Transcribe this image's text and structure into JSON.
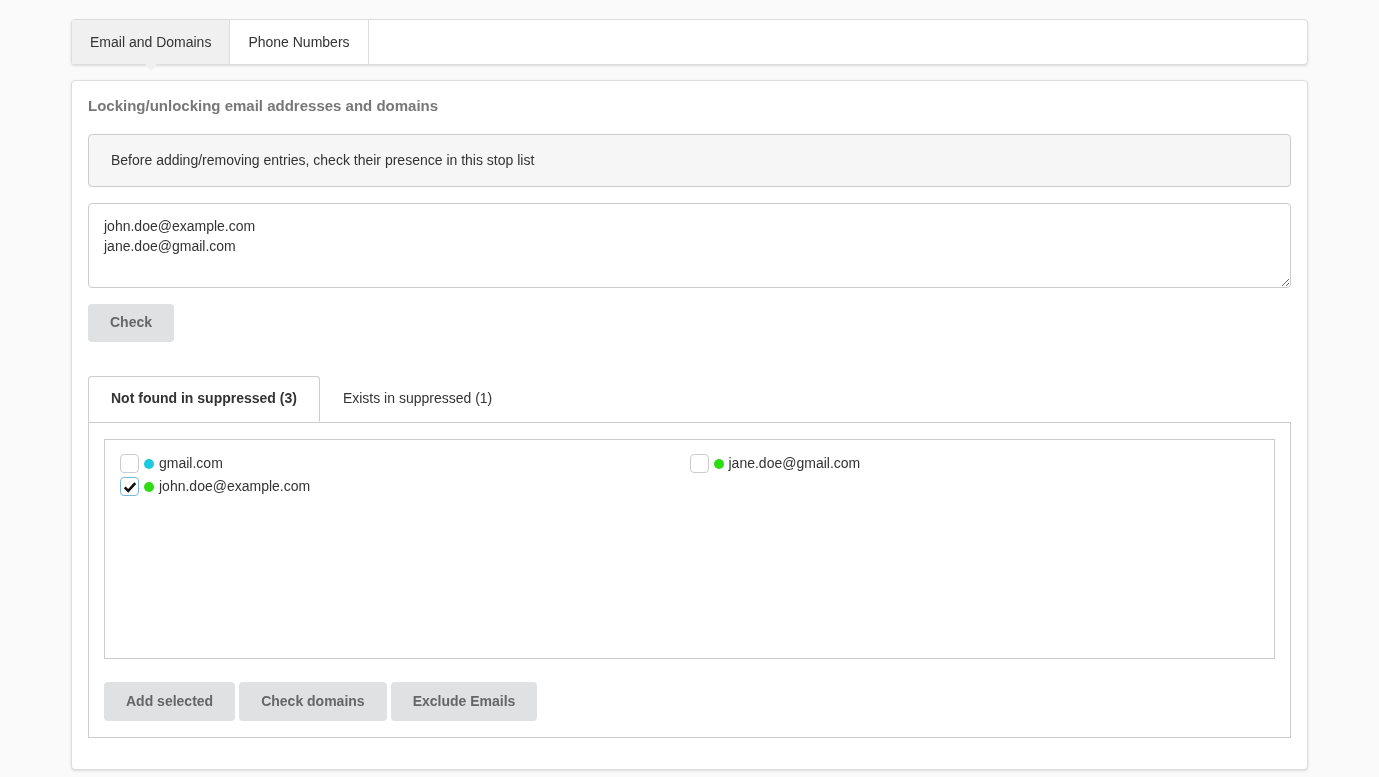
{
  "top_tabs": [
    {
      "label": "Email and Domains",
      "selected": true
    },
    {
      "label": "Phone Numbers",
      "selected": false
    }
  ],
  "panel": {
    "title": "Locking/unlocking email addresses and domains",
    "notice": "Before adding/removing entries, check their presence in this stop list",
    "input": {
      "value": "john.doe@example.com\njane.doe@gmail.com"
    },
    "check_button": "Check",
    "result_tabs": [
      {
        "label": "Not found in suppressed (3)",
        "selected": true
      },
      {
        "label": "Exists in suppressed (1)",
        "selected": false
      }
    ],
    "items": [
      {
        "label": "gmail.com",
        "checked": false,
        "color": "#1ec8e0"
      },
      {
        "label": "jane.doe@gmail.com",
        "checked": false,
        "color": "#2edc12"
      },
      {
        "label": "john.doe@example.com",
        "checked": true,
        "color": "#2edc12"
      }
    ],
    "buttons": [
      "Add selected",
      "Check domains",
      "Exclude Emails"
    ]
  }
}
